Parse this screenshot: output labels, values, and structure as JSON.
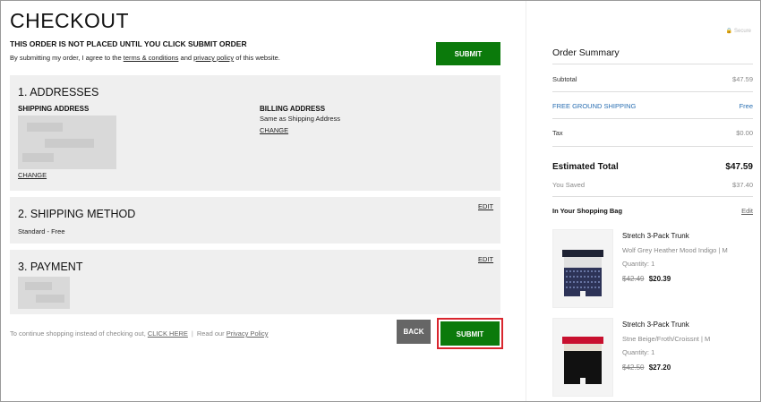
{
  "page": {
    "title": "CHECKOUT",
    "notice": "THIS ORDER IS NOT PLACED UNTIL YOU CLICK SUBMIT ORDER",
    "agree_prefix": "By submitting my order, I agree to the ",
    "terms_link": "terms & conditions",
    "agree_and": " and ",
    "privacy_link": "privacy policy",
    "agree_suffix": " of this website.",
    "submit_label": "SUBMIT ORDER",
    "back_label": "BACK",
    "secure_label": "Secure"
  },
  "addresses": {
    "title": "1. ADDRESSES",
    "shipping_title": "SHIPPING ADDRESS",
    "billing_title": "BILLING ADDRESS",
    "billing_value": "Same as Shipping Address",
    "change_label": "CHANGE"
  },
  "shipping_method": {
    "title": "2. SHIPPING METHOD",
    "value": "Standard  - Free",
    "edit_label": "EDIT"
  },
  "payment": {
    "title": "3. PAYMENT",
    "edit_label": "EDIT"
  },
  "footer": {
    "text": "To continue shopping instead of checking out, ",
    "click_here": "CLICK HERE",
    "read_our": "Read our ",
    "privacy_policy": "Privacy Policy"
  },
  "summary": {
    "title": "Order Summary",
    "subtotal_label": "Subtotal",
    "subtotal_value": "$47.59",
    "shipping_label": "FREE GROUND SHIPPING",
    "shipping_value": "Free",
    "tax_label": "Tax",
    "tax_value": "$0.00",
    "total_label": "Estimated Total",
    "total_value": "$47.59",
    "saved_label": "You Saved",
    "saved_value": "$37.40",
    "bag_label": "In Your Shopping Bag",
    "bag_edit": "Edit"
  },
  "products": [
    {
      "name": "Stretch 3-Pack Trunk",
      "color": "Wolf Grey Heather Mood Indigo  |  M",
      "quantity": "Quantity: 1",
      "was": "$42.49",
      "now": "$20.39"
    },
    {
      "name": "Stretch 3-Pack Trunk",
      "color": "Stne Beige/Froth/Croissnt  |  M",
      "quantity": "Quantity: 1",
      "was": "$42.50",
      "now": "$27.20"
    }
  ],
  "colors": {
    "accent_green": "#0b7a0b",
    "highlight_red": "#d9262e",
    "link_blue": "#2a6fb2"
  }
}
